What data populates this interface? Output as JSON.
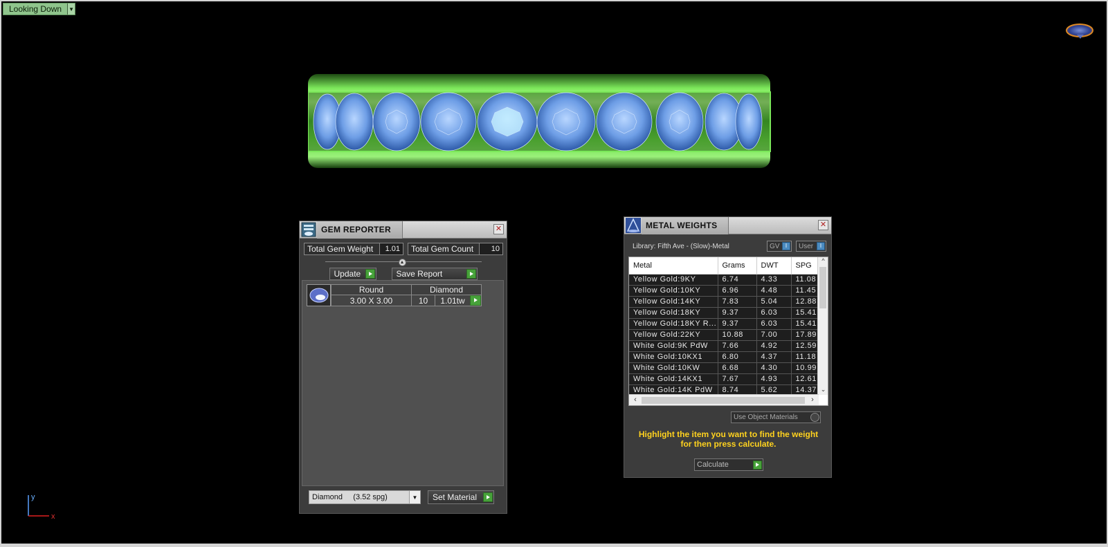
{
  "viewport": {
    "view_label": "Looking Down",
    "axis": {
      "y": "y",
      "x": "x"
    }
  },
  "gem_reporter": {
    "title": "GEM REPORTER",
    "total_weight_label": "Total Gem Weight",
    "total_weight_value": "1.01",
    "total_count_label": "Total Gem Count",
    "total_count_value": "10",
    "update_label": "Update",
    "save_report_label": "Save Report",
    "gem": {
      "shape": "Round",
      "material": "Diamond",
      "size": "3.00 X 3.00",
      "count": "10",
      "weight": "1.01tw"
    },
    "material_select_value": "Diamond     (3.52 spg)",
    "set_material_label": "Set Material"
  },
  "metal_weights": {
    "title": "METAL WEIGHTS",
    "library": "Library: Fifth Ave - (Slow)-Metal",
    "toggle_gv": "GV",
    "toggle_user": "User",
    "columns": [
      "Metal",
      "Grams",
      "DWT",
      "SPG"
    ],
    "rows": [
      [
        "Yellow Gold:9KY",
        "6.74",
        "4.33",
        "11.08"
      ],
      [
        "Yellow Gold:10KY",
        "6.96",
        "4.48",
        "11.45"
      ],
      [
        "Yellow Gold:14KY",
        "7.83",
        "5.04",
        "12.88"
      ],
      [
        "Yellow Gold:18KY",
        "9.37",
        "6.03",
        "15.41"
      ],
      [
        "Yellow Gold:18KY R...",
        "9.37",
        "6.03",
        "15.41"
      ],
      [
        "Yellow Gold:22KY",
        "10.88",
        "7.00",
        "17.89"
      ],
      [
        "White Gold:9K PdW",
        "7.66",
        "4.92",
        "12.59"
      ],
      [
        "White Gold:10KX1",
        "6.80",
        "4.37",
        "11.18"
      ],
      [
        "White Gold:10KW",
        "6.68",
        "4.30",
        "10.99"
      ],
      [
        "White Gold:14KX1",
        "7.67",
        "4.93",
        "12.61"
      ],
      [
        "White Gold:14K PdW",
        "8.74",
        "5.62",
        "14.37"
      ]
    ],
    "use_object_materials": "Use Object Materials",
    "hint_line1": "Highlight the item you want to find the weight",
    "hint_line2": "for then press calculate.",
    "calculate_label": "Calculate"
  }
}
